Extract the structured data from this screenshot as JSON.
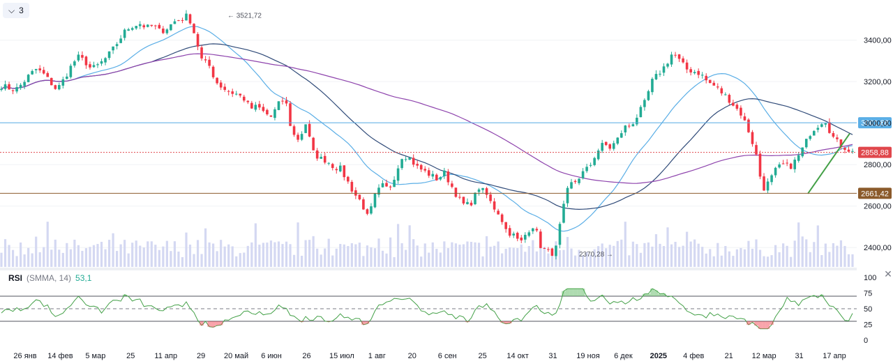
{
  "toolbar": {
    "collapse_icon": "chevron-down-icon",
    "indicator_count": "3"
  },
  "rsi": {
    "name": "RSI",
    "params": "(SMMA, 14)",
    "value": "53,1",
    "close_icon": "close-icon",
    "levels": [
      70,
      50,
      30
    ]
  },
  "colors": {
    "up": "#22ab94",
    "down": "#f23645",
    "ma_light": "#5aaee6",
    "ma_dark": "#2f4a78",
    "ma_purple": "#8e44ad",
    "volume": "#d4d8f2",
    "rsi_line": "#43a047",
    "label_blue": "#5aaee6",
    "label_red": "#e0474c",
    "label_brown": "#8b5a2b"
  },
  "chart_data": {
    "type": "candlestick",
    "price_axis_ticks": [
      "3400,00",
      "3200,00",
      "3000,00",
      "2800,00",
      "2600,00",
      "2400,00"
    ],
    "rsi_axis_ticks": [
      "100",
      "75",
      "50",
      "25",
      "0"
    ],
    "x_ticks": [
      {
        "label": "26 янв",
        "bold": false
      },
      {
        "label": "14 фев",
        "bold": false
      },
      {
        "label": "5 мар",
        "bold": false
      },
      {
        "label": "25",
        "bold": false
      },
      {
        "label": "11 апр",
        "bold": false
      },
      {
        "label": "29",
        "bold": false
      },
      {
        "label": "20 май",
        "bold": false
      },
      {
        "label": "6 июн",
        "bold": false
      },
      {
        "label": "26",
        "bold": false
      },
      {
        "label": "15 июл",
        "bold": false
      },
      {
        "label": "1 авг",
        "bold": false
      },
      {
        "label": "20",
        "bold": false
      },
      {
        "label": "6 сен",
        "bold": false
      },
      {
        "label": "25",
        "bold": false
      },
      {
        "label": "14 окт",
        "bold": false
      },
      {
        "label": "31",
        "bold": false
      },
      {
        "label": "19 ноя",
        "bold": false
      },
      {
        "label": "6 дек",
        "bold": false
      },
      {
        "label": "2025",
        "bold": true
      },
      {
        "label": "4 фев",
        "bold": false
      },
      {
        "label": "21",
        "bold": false
      },
      {
        "label": "12 мар",
        "bold": false
      },
      {
        "label": "31",
        "bold": false
      },
      {
        "label": "17 апр",
        "bold": false
      }
    ],
    "ylim": [
      2300,
      3560
    ],
    "close_path": [
      3180,
      3170,
      3160,
      3190,
      3230,
      3260,
      3240,
      3200,
      3160,
      3210,
      3270,
      3320,
      3300,
      3260,
      3280,
      3310,
      3350,
      3400,
      3450,
      3470,
      3480,
      3460,
      3470,
      3440,
      3460,
      3490,
      3500,
      3521.72,
      3420,
      3300,
      3280,
      3200,
      3170,
      3150,
      3140,
      3120,
      3070,
      3080,
      3050,
      3030,
      3090,
      3120,
      2950,
      2920,
      3000,
      2860,
      2830,
      2820,
      2790,
      2780,
      2720,
      2660,
      2620,
      2540,
      2650,
      2700,
      2680,
      2760,
      2850,
      2830,
      2790,
      2770,
      2750,
      2730,
      2760,
      2700,
      2640,
      2600,
      2620,
      2690,
      2660,
      2600,
      2560,
      2480,
      2460,
      2420,
      2480,
      2510,
      2400,
      2380,
      2370.28,
      2560,
      2700,
      2720,
      2760,
      2790,
      2860,
      2900,
      2880,
      2920,
      2980,
      2990,
      3040,
      3100,
      3200,
      3240,
      3280,
      3340,
      3300,
      3260,
      3250,
      3240,
      3200,
      3180,
      3150,
      3120,
      3080,
      3040,
      2960,
      2860,
      2680,
      2720,
      2780,
      2800,
      2790,
      2830,
      2890,
      2960,
      2990,
      3020,
      2940,
      2900,
      2880,
      2860
    ],
    "price_lines": [
      {
        "value": 3001.88,
        "label": "3001,88",
        "color": "#5aaee6"
      },
      {
        "value": 2858.88,
        "label": "2858,88",
        "color": "#e0474c",
        "dotted": true
      },
      {
        "value": 2661.42,
        "label": "2661,42",
        "color": "#8b5a2b"
      }
    ],
    "annotations": [
      {
        "text": "← 3521,72",
        "value": 3521.72
      },
      {
        "text": "2370,28 →",
        "value": 2370.28
      }
    ]
  }
}
